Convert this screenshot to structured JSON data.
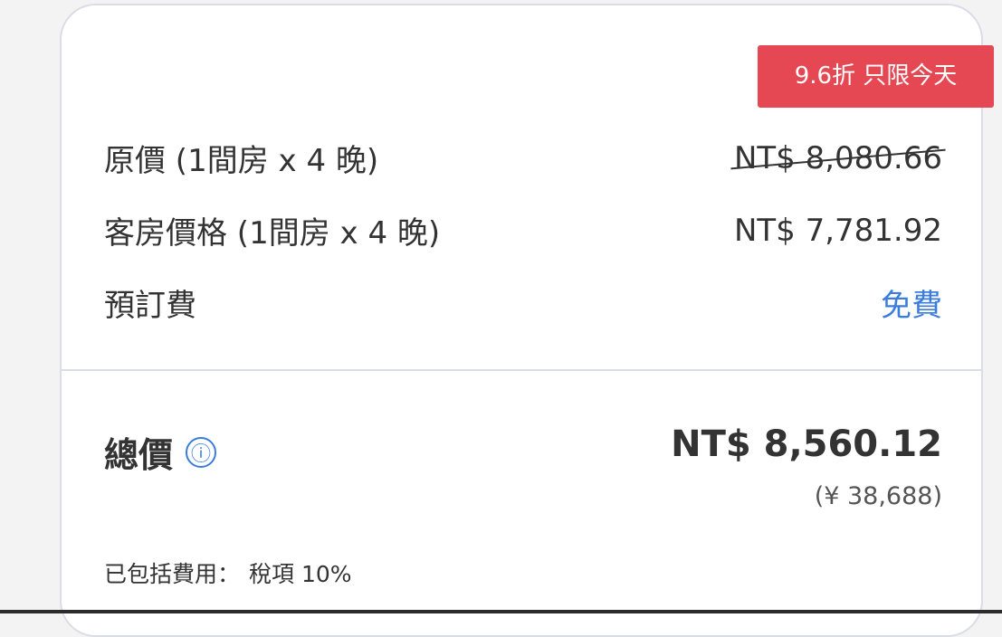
{
  "badge": "9.6折 只限今天",
  "rows": [
    {
      "label": "原價 (1間房 x 4 晚)",
      "value": "NT$ 8,080.66"
    },
    {
      "label": "客房價格 (1間房 x 4 晚)",
      "value": "NT$ 7,781.92"
    },
    {
      "label": "預訂費",
      "value": "免費"
    }
  ],
  "total": {
    "label": "總價",
    "info_icon": "ⓘ",
    "value": "NT$ 8,560.12",
    "converted": "(¥ 38,688)"
  },
  "included": {
    "label": "已包括費用：",
    "items": "稅項 10%"
  },
  "colors": {
    "badge_bg": "#e54852",
    "accent_blue": "#3b7ddd",
    "text": "#333333"
  },
  "icons": {
    "info": "info-icon"
  }
}
